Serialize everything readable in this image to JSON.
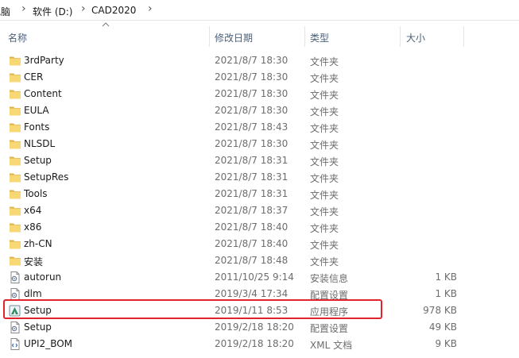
{
  "breadcrumb": {
    "items": [
      "电脑",
      "软件 (D:)",
      "CAD2020"
    ],
    "separator": "›"
  },
  "columns": {
    "name": "名称",
    "date": "修改日期",
    "type": "类型",
    "size": "大小"
  },
  "sort": {
    "column": "name",
    "direction": "ascending"
  },
  "colors": {
    "folder": "#f8d775",
    "highlight_border": "#e0242a",
    "header_text": "#4c607a"
  },
  "files": [
    {
      "name": "3rdParty",
      "date": "2021/8/7 18:30",
      "type": "文件夹",
      "size": "",
      "icon": "folder-icon"
    },
    {
      "name": "CER",
      "date": "2021/8/7 18:30",
      "type": "文件夹",
      "size": "",
      "icon": "folder-icon"
    },
    {
      "name": "Content",
      "date": "2021/8/7 18:30",
      "type": "文件夹",
      "size": "",
      "icon": "folder-icon"
    },
    {
      "name": "EULA",
      "date": "2021/8/7 18:30",
      "type": "文件夹",
      "size": "",
      "icon": "folder-icon"
    },
    {
      "name": "Fonts",
      "date": "2021/8/7 18:43",
      "type": "文件夹",
      "size": "",
      "icon": "folder-icon"
    },
    {
      "name": "NLSDL",
      "date": "2021/8/7 18:30",
      "type": "文件夹",
      "size": "",
      "icon": "folder-icon"
    },
    {
      "name": "Setup",
      "date": "2021/8/7 18:31",
      "type": "文件夹",
      "size": "",
      "icon": "folder-icon"
    },
    {
      "name": "SetupRes",
      "date": "2021/8/7 18:31",
      "type": "文件夹",
      "size": "",
      "icon": "folder-icon"
    },
    {
      "name": "Tools",
      "date": "2021/8/7 18:31",
      "type": "文件夹",
      "size": "",
      "icon": "folder-icon"
    },
    {
      "name": "x64",
      "date": "2021/8/7 18:37",
      "type": "文件夹",
      "size": "",
      "icon": "folder-icon"
    },
    {
      "name": "x86",
      "date": "2021/8/7 18:40",
      "type": "文件夹",
      "size": "",
      "icon": "folder-icon"
    },
    {
      "name": "zh-CN",
      "date": "2021/8/7 18:40",
      "type": "文件夹",
      "size": "",
      "icon": "folder-icon"
    },
    {
      "name": "安装",
      "date": "2021/8/7 18:48",
      "type": "文件夹",
      "size": "",
      "icon": "folder-icon"
    },
    {
      "name": "autorun",
      "date": "2011/10/25 9:14",
      "type": "安装信息",
      "size": "1 KB",
      "icon": "settings-file-icon"
    },
    {
      "name": "dlm",
      "date": "2019/3/4 17:34",
      "type": "配置设置",
      "size": "1 KB",
      "icon": "settings-file-icon"
    },
    {
      "name": "Setup",
      "date": "2019/1/11 8:53",
      "type": "应用程序",
      "size": "978 KB",
      "icon": "setup-exe-icon",
      "highlighted": true
    },
    {
      "name": "Setup",
      "date": "2019/2/18 18:20",
      "type": "配置设置",
      "size": "49 KB",
      "icon": "settings-file-icon"
    },
    {
      "name": "UPI2_BOM",
      "date": "2019/2/18 18:20",
      "type": "XML 文档",
      "size": "9 KB",
      "icon": "xml-file-icon"
    }
  ]
}
